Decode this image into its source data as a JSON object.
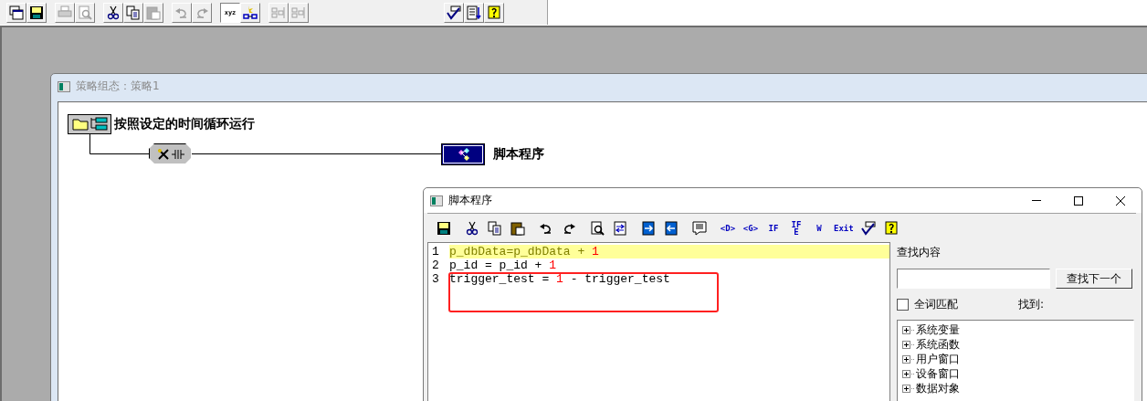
{
  "main_toolbar": {
    "buttons": [
      {
        "kind": "windows",
        "disabled": false,
        "pressed": false
      },
      {
        "kind": "save",
        "disabled": false,
        "pressed": false
      },
      {
        "kind": "print",
        "disabled": true,
        "pressed": false
      },
      {
        "kind": "preview",
        "disabled": true,
        "pressed": false
      },
      {
        "kind": "cut",
        "disabled": false,
        "pressed": false
      },
      {
        "kind": "copy",
        "disabled": false,
        "pressed": false
      },
      {
        "kind": "paste",
        "disabled": true,
        "pressed": false
      },
      {
        "kind": "undo",
        "disabled": true,
        "pressed": false
      },
      {
        "kind": "redo",
        "disabled": true,
        "pressed": false
      },
      {
        "kind": "label",
        "label": "xyz",
        "disabled": false,
        "pressed": true
      },
      {
        "kind": "spark",
        "disabled": false,
        "pressed": false
      },
      {
        "kind": "blocks",
        "disabled": true,
        "pressed": false
      },
      {
        "kind": "blocks",
        "disabled": true,
        "pressed": false
      },
      {
        "kind": "check",
        "disabled": false,
        "pressed": false
      },
      {
        "kind": "sort",
        "disabled": false,
        "pressed": false
      },
      {
        "kind": "help",
        "disabled": false,
        "pressed": false
      }
    ]
  },
  "strategy_window": {
    "title": "策略组态：策略1",
    "condition": {
      "label": "按照设定的时间循环运行"
    },
    "script_node": {
      "label": "脚本程序"
    }
  },
  "script_window": {
    "title": "脚本程序",
    "toolbar": [
      {
        "kind": "save"
      },
      {
        "kind": "cut"
      },
      {
        "kind": "copy"
      },
      {
        "kind": "paste"
      },
      {
        "kind": "undo"
      },
      {
        "kind": "redo"
      },
      {
        "kind": "preview"
      },
      {
        "kind": "replace"
      },
      {
        "kind": "import"
      },
      {
        "kind": "export"
      },
      {
        "kind": "comment"
      },
      {
        "kind": "label",
        "label": "<D>"
      },
      {
        "kind": "label",
        "label": "<G>"
      },
      {
        "kind": "label",
        "label": "IF"
      },
      {
        "kind": "label",
        "label": "IF\nE"
      },
      {
        "kind": "label",
        "label": "W"
      },
      {
        "kind": "label",
        "label": "Exit"
      },
      {
        "kind": "check"
      },
      {
        "kind": "help"
      }
    ],
    "lines": [
      {
        "number": "1",
        "highlighted": true,
        "tokens": [
          {
            "kind": "text",
            "text": "p_dbData=p_dbData + "
          },
          {
            "kind": "number",
            "text": "1"
          }
        ]
      },
      {
        "number": "2",
        "highlighted": false,
        "tokens": [
          {
            "kind": "text",
            "text": "p_id = p_id + "
          },
          {
            "kind": "number",
            "text": "1"
          }
        ]
      },
      {
        "number": "3",
        "highlighted": false,
        "tokens": [
          {
            "kind": "text",
            "text": "trigger_test = "
          },
          {
            "kind": "number",
            "text": "1"
          },
          {
            "kind": "text",
            "text": " - trigger_test"
          }
        ]
      }
    ],
    "find": {
      "label": "查找内容",
      "button": "查找下一个",
      "whole_word": {
        "label": "全词匹配",
        "checked": false
      },
      "found_label": "找到:"
    },
    "tree": [
      {
        "label": "系统变量",
        "expanded": false
      },
      {
        "label": "系统函数",
        "expanded": false
      },
      {
        "label": "用户窗口",
        "expanded": false
      },
      {
        "label": "设备窗口",
        "expanded": false
      },
      {
        "label": "数据对象",
        "expanded": false
      }
    ]
  }
}
